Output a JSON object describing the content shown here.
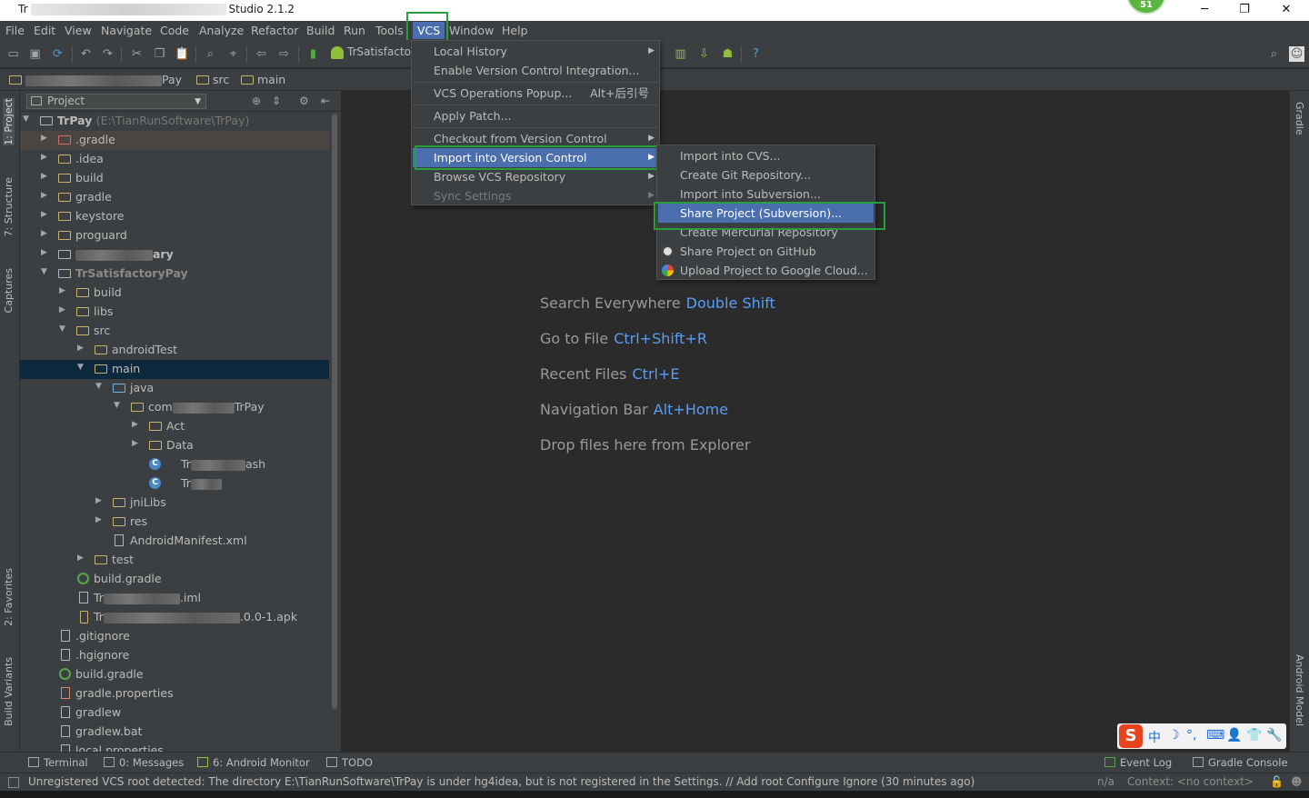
{
  "window": {
    "title_prefix": "Tr",
    "title_suffix": "Studio 2.1.2",
    "notification_count": "51",
    "controls": {
      "minimize": "─",
      "restore": "❐",
      "close": "✕"
    }
  },
  "menubar": {
    "items": [
      "File",
      "Edit",
      "View",
      "Navigate",
      "Code",
      "Analyze",
      "Refactor",
      "Build",
      "Run",
      "Tools",
      "VCS",
      "Window",
      "Help"
    ]
  },
  "toolbar": {
    "run_config": "TrSatisfacto"
  },
  "breadcrumb": {
    "items": [
      "Pay",
      "src",
      "main"
    ]
  },
  "left_stripe": {
    "tabs": [
      "1: Project",
      "7: Structure",
      "Captures",
      "2: Favorites",
      "Build Variants"
    ]
  },
  "right_stripe": {
    "tabs": [
      "Gradle",
      "Android Model"
    ]
  },
  "project_panel": {
    "view_mode": "Project",
    "tree": [
      {
        "label": "TrPay",
        "path": "(E:\\TianRunSoftware\\TrPay)"
      },
      {
        "label": ".gradle"
      },
      {
        "label": ".idea"
      },
      {
        "label": "build"
      },
      {
        "label": "gradle"
      },
      {
        "label": "keystore"
      },
      {
        "label": "proguard"
      },
      {
        "label": "ary"
      },
      {
        "label": "TrSatisfactoryPay"
      },
      {
        "label": "build"
      },
      {
        "label": "libs"
      },
      {
        "label": "src"
      },
      {
        "label": "androidTest"
      },
      {
        "label": "main"
      },
      {
        "label": "java"
      },
      {
        "label": "com",
        "suffix": "TrPay"
      },
      {
        "label": "Act"
      },
      {
        "label": "Data"
      },
      {
        "label": "Tr",
        "suffix": "ash"
      },
      {
        "label": "Tr"
      },
      {
        "label": "jniLibs"
      },
      {
        "label": "res"
      },
      {
        "label": "AndroidManifest.xml"
      },
      {
        "label": "test"
      },
      {
        "label": "build.gradle"
      },
      {
        "label": "Tr",
        "suffix": ".iml"
      },
      {
        "label": "Tr",
        "suffix": ".0.0-1.apk"
      },
      {
        "label": ".gitignore"
      },
      {
        "label": ".hgignore"
      },
      {
        "label": "build.gradle"
      },
      {
        "label": "gradle.properties"
      },
      {
        "label": "gradlew"
      },
      {
        "label": "gradlew.bat"
      },
      {
        "label": "local.properties"
      }
    ]
  },
  "editor_hints": [
    {
      "text": "Search Everywhere",
      "key": "Double Shift"
    },
    {
      "text": "Go to File",
      "key": "Ctrl+Shift+R"
    },
    {
      "text": "Recent Files",
      "key": "Ctrl+E"
    },
    {
      "text": "Navigation Bar",
      "key": "Alt+Home"
    },
    {
      "text": "Drop files here from Explorer",
      "key": ""
    }
  ],
  "vcs_menu": {
    "items": [
      {
        "label": "Local History",
        "submenu": true
      },
      {
        "label": "Enable Version Control Integration..."
      },
      {
        "label": "VCS Operations Popup...",
        "shortcut": "Alt+后引号"
      },
      {
        "label": "Apply Patch..."
      },
      {
        "label": "Checkout from Version Control",
        "submenu": true
      },
      {
        "label": "Import into Version Control",
        "submenu": true,
        "selected": true
      },
      {
        "label": "Browse VCS Repository",
        "submenu": true
      },
      {
        "label": "Sync Settings",
        "submenu": true,
        "disabled": true
      }
    ]
  },
  "import_submenu": {
    "items": [
      {
        "label": "Import into CVS..."
      },
      {
        "label": "Create Git Repository..."
      },
      {
        "label": "Import into Subversion..."
      },
      {
        "label": "Share Project (Subversion)...",
        "selected": true
      },
      {
        "label": "Create Mercurial Repository"
      },
      {
        "label": "Share Project on GitHub"
      },
      {
        "label": "Upload Project to Google Cloud..."
      }
    ]
  },
  "bottom_tabs": {
    "left": [
      "Terminal",
      "0: Messages",
      "6: Android Monitor",
      "TODO"
    ],
    "right": [
      "Event Log",
      "Gradle Console"
    ]
  },
  "status_bar": {
    "message": "Unregistered VCS root detected: The directory E:\\TianRunSoftware\\TrPay is under hg4idea, but is not registered in the Settings. // Add root  Configure  Ignore (30 minutes ago)",
    "position": "n/a",
    "context": "Context: <no context>"
  },
  "ime": {
    "logo": "S",
    "glyphs": [
      "中",
      "☽",
      "°,",
      "⌨",
      "👤",
      "👕",
      "🔧"
    ]
  },
  "colors": {
    "selection": "#4b6eaf",
    "highlight_box": "#27a03c",
    "link_key": "#589df6"
  }
}
